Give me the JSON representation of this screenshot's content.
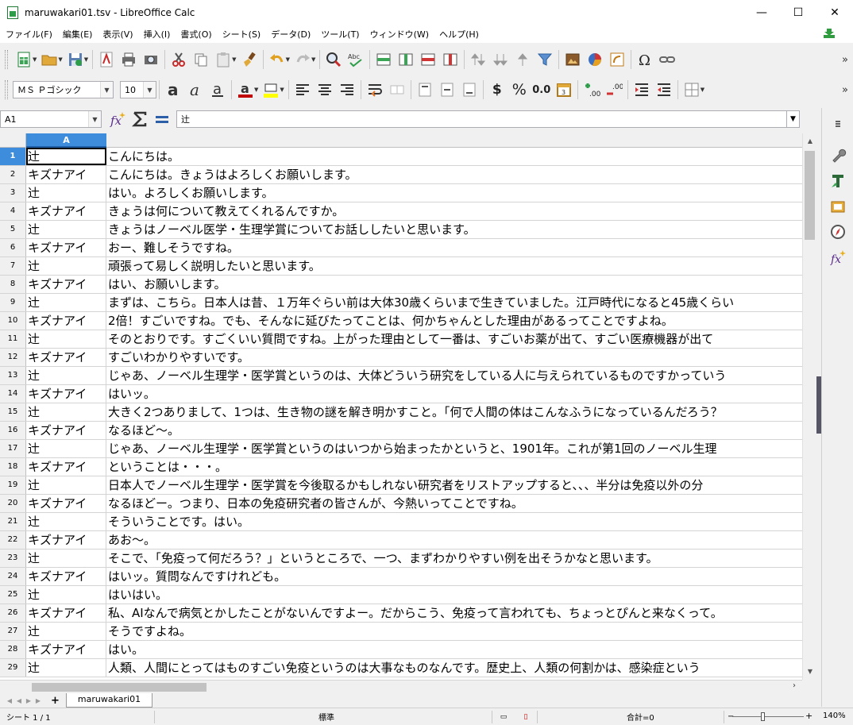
{
  "window": {
    "title": "maruwakari01.tsv - LibreOffice Calc",
    "minimize": "—",
    "maximize": "☐",
    "close": "✕"
  },
  "menu": [
    "ファイル(F)",
    "編集(E)",
    "表示(V)",
    "挿入(I)",
    "書式(O)",
    "シート(S)",
    "データ(D)",
    "ツール(T)",
    "ウィンドウ(W)",
    "ヘルプ(H)"
  ],
  "format_toolbar": {
    "font_name": "ＭＳ Ｐゴシック",
    "font_size": "10",
    "currency": "$",
    "percent": "%",
    "decimal": "0.0"
  },
  "formula_bar": {
    "name_box": "A1",
    "content": "辻"
  },
  "columns": [
    "A"
  ],
  "rows": [
    {
      "n": "1",
      "a": "辻",
      "b": "こんにちは。"
    },
    {
      "n": "2",
      "a": "キズナアイ",
      "b": "こんにちは。きょうはよろしくお願いします。"
    },
    {
      "n": "3",
      "a": "辻",
      "b": "はい。よろしくお願いします。"
    },
    {
      "n": "4",
      "a": "キズナアイ",
      "b": "きょうは何について教えてくれるんですか。"
    },
    {
      "n": "5",
      "a": "辻",
      "b": "きょうはノーベル医学・生理学賞についてお話ししたいと思います。"
    },
    {
      "n": "6",
      "a": "キズナアイ",
      "b": "おー、難しそうですね。"
    },
    {
      "n": "7",
      "a": "辻",
      "b": "頑張って易しく説明したいと思います。"
    },
    {
      "n": "8",
      "a": "キズナアイ",
      "b": "はい、お願いします。"
    },
    {
      "n": "9",
      "a": "辻",
      "b": "まずは、こちら。日本人は昔、１万年ぐらい前は大体30歳くらいまで生きていました。江戸時代になると45歳くらい"
    },
    {
      "n": "10",
      "a": "キズナアイ",
      "b": "2倍！すごいですね。でも、そんなに延びたってことは、何かちゃんとした理由があるってことですよね。"
    },
    {
      "n": "11",
      "a": "辻",
      "b": "そのとおりです。すごくいい質問ですね。上がった理由として一番は、すごいお薬が出て、すごい医療機器が出て"
    },
    {
      "n": "12",
      "a": "キズナアイ",
      "b": "すごいわかりやすいです。"
    },
    {
      "n": "13",
      "a": "辻",
      "b": "じゃあ、ノーベル生理学・医学賞というのは、大体どういう研究をしている人に与えられているものですかっていう"
    },
    {
      "n": "14",
      "a": "キズナアイ",
      "b": "はいッ。"
    },
    {
      "n": "15",
      "a": "辻",
      "b": "大きく2つありまして、1つは、生き物の謎を解き明かすこと。「何で人間の体はこんなふうになっているんだろう？"
    },
    {
      "n": "16",
      "a": "キズナアイ",
      "b": "なるほど～。"
    },
    {
      "n": "17",
      "a": "辻",
      "b": "じゃあ、ノーベル生理学・医学賞というのはいつから始まったかというと、1901年。これが第1回のノーベル生理"
    },
    {
      "n": "18",
      "a": "キズナアイ",
      "b": "ということは・・・。"
    },
    {
      "n": "19",
      "a": "辻",
      "b": "日本人でノーベル生理学・医学賞を今後取るかもしれない研究者をリストアップすると、、、半分は免疫以外の分"
    },
    {
      "n": "20",
      "a": "キズナアイ",
      "b": "なるほどー。つまり、日本の免疫研究者の皆さんが、今熱いってことですね。"
    },
    {
      "n": "21",
      "a": "辻",
      "b": "そういうことです。はい。"
    },
    {
      "n": "22",
      "a": "キズナアイ",
      "b": "あお～。"
    },
    {
      "n": "23",
      "a": "辻",
      "b": "そこで、「免疫って何だろう？」というところで、一つ、まずわかりやすい例を出そうかなと思います。"
    },
    {
      "n": "24",
      "a": "キズナアイ",
      "b": "はいッ。質問なんですけれども。"
    },
    {
      "n": "25",
      "a": "辻",
      "b": "はいはい。"
    },
    {
      "n": "26",
      "a": "キズナアイ",
      "b": "私、AIなんで病気とかしたことがないんですよー。だからこう、免疫って言われても、ちょっとぴんと来なくって。"
    },
    {
      "n": "27",
      "a": "辻",
      "b": "そうですよね。"
    },
    {
      "n": "28",
      "a": "キズナアイ",
      "b": "はい。"
    },
    {
      "n": "29",
      "a": "辻",
      "b": "人類、人間にとってはものすごい免疫というのは大事なものなんです。歴史上、人類の何割かは、感染症という"
    }
  ],
  "sheet_tab": "maruwakari01",
  "status": {
    "sheet": "シート 1 / 1",
    "style": "標準",
    "sum": "合計=0",
    "zoom": "140%",
    "zoom_level_percent": 140
  },
  "colors": {
    "selection_header": "#3e8ddd",
    "toolbar_bg": "#f0f0f0"
  }
}
